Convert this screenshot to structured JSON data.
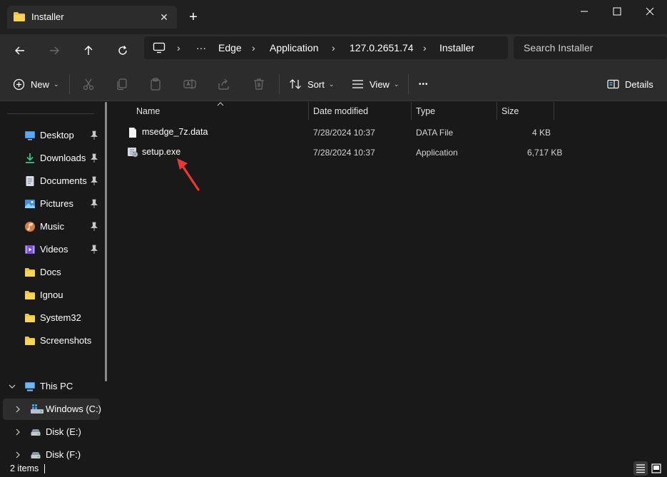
{
  "tab": {
    "title": "Installer",
    "close": "✕",
    "new_tab": "+"
  },
  "window": {
    "minimize": "—",
    "maximize": "☐",
    "close": "✕"
  },
  "address": {
    "overflow": "···",
    "crumbs": [
      "Edge",
      "Application",
      "127.0.2651.74",
      "Installer"
    ],
    "separator": "›"
  },
  "search": {
    "placeholder": "Search Installer"
  },
  "toolbar": {
    "new_label": "New",
    "sort_label": "Sort",
    "view_label": "View",
    "more_label": "•••",
    "details_label": "Details"
  },
  "sidebar": {
    "quick_access": [
      {
        "label": "Desktop",
        "icon": "desktop-icon",
        "pinned": true
      },
      {
        "label": "Downloads",
        "icon": "download-icon",
        "pinned": true
      },
      {
        "label": "Documents",
        "icon": "documents-icon",
        "pinned": true
      },
      {
        "label": "Pictures",
        "icon": "pictures-icon",
        "pinned": true
      },
      {
        "label": "Music",
        "icon": "music-icon",
        "pinned": true
      },
      {
        "label": "Videos",
        "icon": "videos-icon",
        "pinned": true
      },
      {
        "label": "Docs",
        "icon": "folder-icon",
        "pinned": false
      },
      {
        "label": "Ignou",
        "icon": "folder-icon",
        "pinned": false
      },
      {
        "label": "System32",
        "icon": "folder-icon",
        "pinned": false
      },
      {
        "label": "Screenshots",
        "icon": "folder-icon",
        "pinned": false
      }
    ],
    "this_pc": "This PC",
    "drives": [
      {
        "label": "Windows (C:)",
        "icon": "drive-c-icon"
      },
      {
        "label": "Disk (E:)",
        "icon": "drive-icon"
      },
      {
        "label": "Disk (F:)",
        "icon": "drive-icon"
      }
    ]
  },
  "columns": {
    "name": "Name",
    "date": "Date modified",
    "type": "Type",
    "size": "Size"
  },
  "files": [
    {
      "name": "msedge_7z.data",
      "date": "7/28/2024 10:37",
      "type": "DATA File",
      "size": "4 KB",
      "icon": "data-file-icon"
    },
    {
      "name": "setup.exe",
      "date": "7/28/2024 10:37",
      "type": "Application",
      "size": "6,717 KB",
      "icon": "setup-exe-icon"
    }
  ],
  "status": {
    "count": "2 items"
  },
  "colors": {
    "accent": "#60cdff",
    "folder": "#f3c33c",
    "arrow": "#e53935"
  }
}
